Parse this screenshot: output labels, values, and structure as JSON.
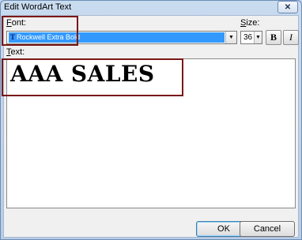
{
  "window": {
    "title": "Edit WordArt Text",
    "close_glyph": "✕"
  },
  "font": {
    "label": "Font:",
    "access_key": "F",
    "selected": "Rockwell Extra Bold",
    "icon": "truetype-font-icon",
    "icon_glyph": "T"
  },
  "size": {
    "label": "Size:",
    "access_key": "S",
    "value": "36"
  },
  "format": {
    "bold_label": "B",
    "italic_label": "I"
  },
  "text": {
    "label": "Text:",
    "access_key": "T",
    "value": "AAA SALES"
  },
  "buttons": {
    "ok": "OK",
    "cancel": "Cancel"
  },
  "colors": {
    "selection": "#3399ff",
    "highlight_box": "#7a1818"
  }
}
